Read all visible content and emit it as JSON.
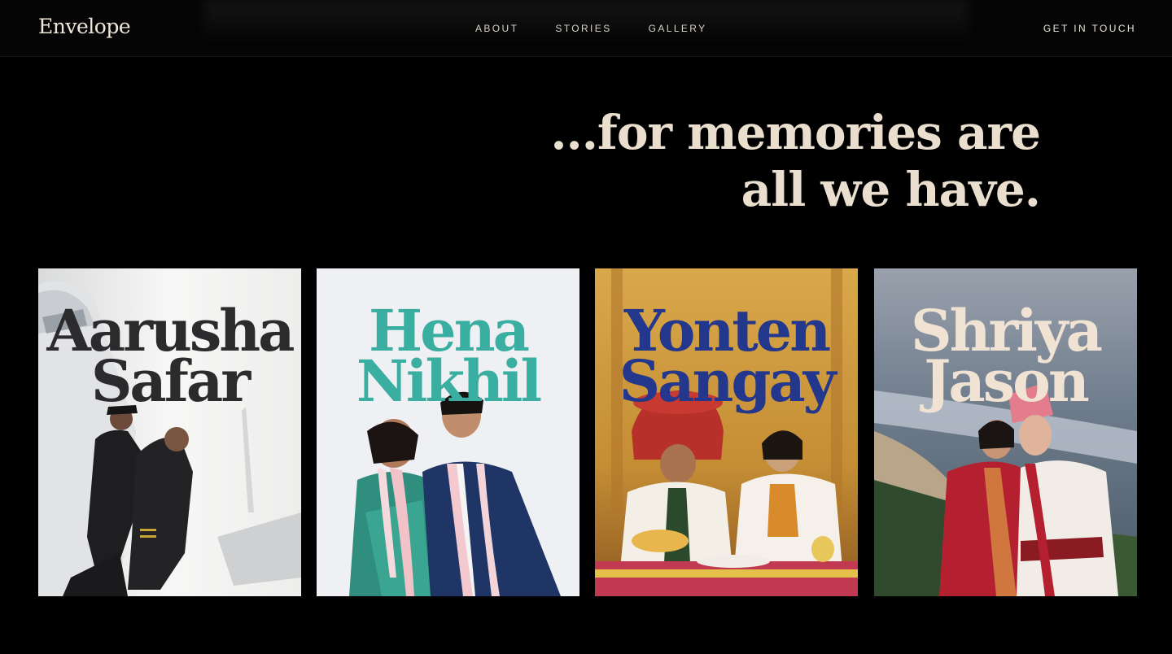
{
  "brand": {
    "logo": "Envelope"
  },
  "nav": {
    "links": [
      "ABOUT",
      "STORIES",
      "GALLERY"
    ],
    "cta": "GET IN TOUCH"
  },
  "hero": {
    "line1": "...for memories are",
    "line2": "all we have."
  },
  "stories": [
    {
      "first": "Aarusha",
      "second": "Safar",
      "color": "#2b2b2e"
    },
    {
      "first": "Hena",
      "second": "Nikhil",
      "color": "#3aaea0"
    },
    {
      "first": "Yonten",
      "second": "Sangay",
      "color": "#23378c"
    },
    {
      "first": "Shriya",
      "second": "Jason",
      "color": "#f1e3d3"
    }
  ]
}
